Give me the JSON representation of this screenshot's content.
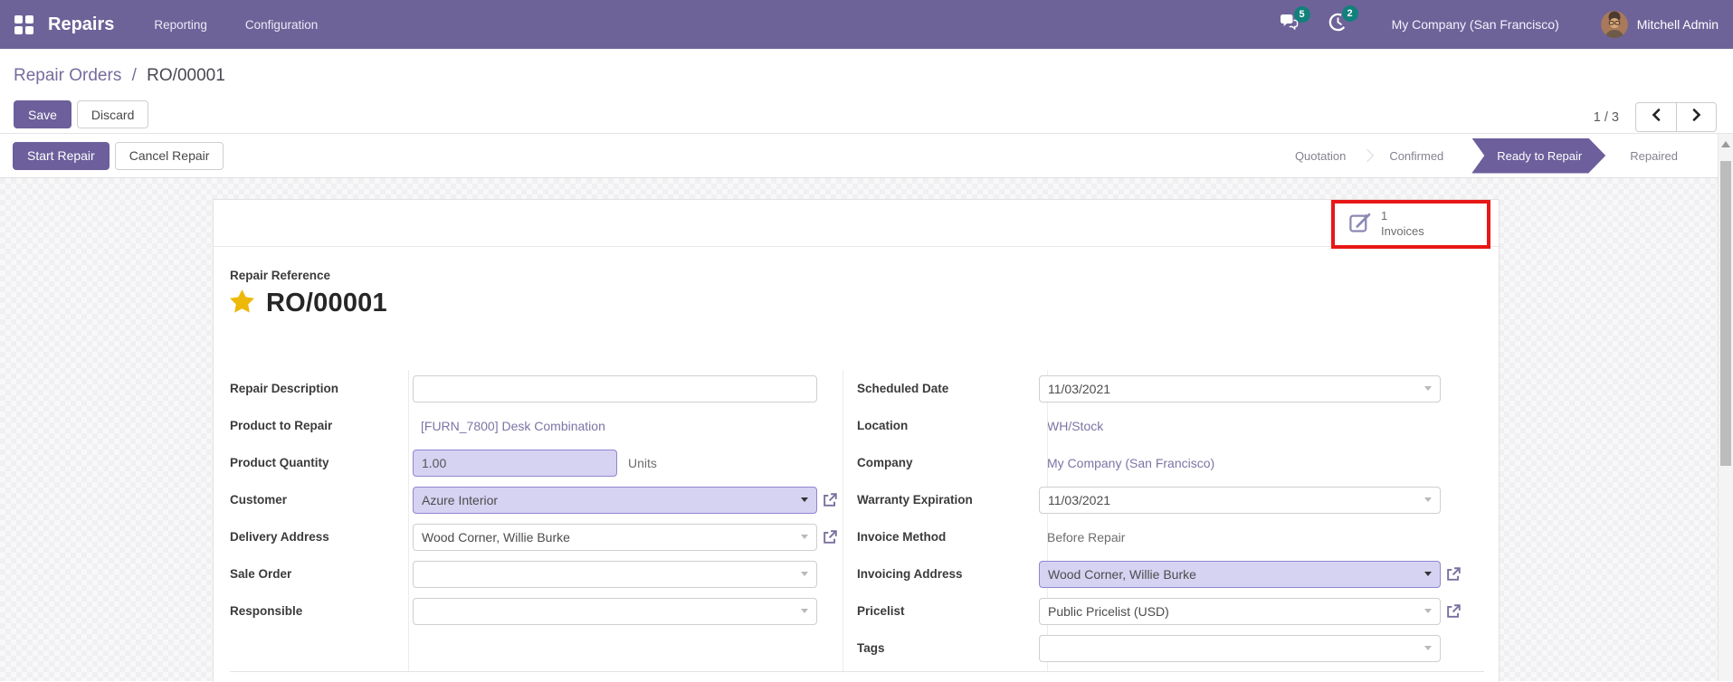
{
  "navbar": {
    "app_name": "Repairs",
    "menus": [
      {
        "label": "Reporting"
      },
      {
        "label": "Configuration"
      }
    ],
    "messages_count": "5",
    "activities_count": "2",
    "company": "My Company (San Francisco)",
    "user": "Mitchell Admin"
  },
  "breadcrumb": {
    "parent": "Repair Orders",
    "separator": "/",
    "current": "RO/00001"
  },
  "actions": {
    "save": "Save",
    "discard": "Discard"
  },
  "pager": {
    "value": "1 / 3"
  },
  "statusbar": {
    "start_repair": "Start Repair",
    "cancel_repair": "Cancel Repair",
    "active_step": "Ready to Repair",
    "steps": [
      {
        "label": "Quotation"
      },
      {
        "label": "Confirmed"
      },
      {
        "label": "Ready to Repair"
      },
      {
        "label": "Repaired"
      }
    ]
  },
  "form": {
    "buttonbox": {
      "invoices_count": "1",
      "invoices_label": "Invoices"
    },
    "title": {
      "label": "Repair Reference",
      "value": "RO/00001"
    },
    "left": {
      "repair_description": {
        "label": "Repair Description",
        "value": ""
      },
      "product_to_repair": {
        "label": "Product to Repair",
        "value": "[FURN_7800] Desk Combination"
      },
      "product_quantity": {
        "label": "Product Quantity",
        "value": "1.00",
        "uom": "Units"
      },
      "customer": {
        "label": "Customer",
        "value": "Azure Interior"
      },
      "delivery_address": {
        "label": "Delivery Address",
        "value": "Wood Corner, Willie Burke"
      },
      "sale_order": {
        "label": "Sale Order",
        "value": ""
      },
      "responsible": {
        "label": "Responsible",
        "value": ""
      }
    },
    "right": {
      "scheduled_date": {
        "label": "Scheduled Date",
        "value": "11/03/2021"
      },
      "location": {
        "label": "Location",
        "value": "WH/Stock"
      },
      "company": {
        "label": "Company",
        "value": "My Company (San Francisco)"
      },
      "warranty_expiration": {
        "label": "Warranty Expiration",
        "value": "11/03/2021"
      },
      "invoice_method": {
        "label": "Invoice Method",
        "value": "Before Repair"
      },
      "invoicing_address": {
        "label": "Invoicing Address",
        "value": "Wood Corner, Willie Burke"
      },
      "pricelist": {
        "label": "Pricelist",
        "value": "Public Pricelist (USD)"
      },
      "tags": {
        "label": "Tags",
        "value": ""
      }
    }
  },
  "colors": {
    "navbar": "#6e6399",
    "accent": "#6c5f9b",
    "badge": "#12807c",
    "highlight": "#d6d2f2",
    "annotation": "#e81717",
    "link": "#7d74a5",
    "star": "#edb807"
  }
}
